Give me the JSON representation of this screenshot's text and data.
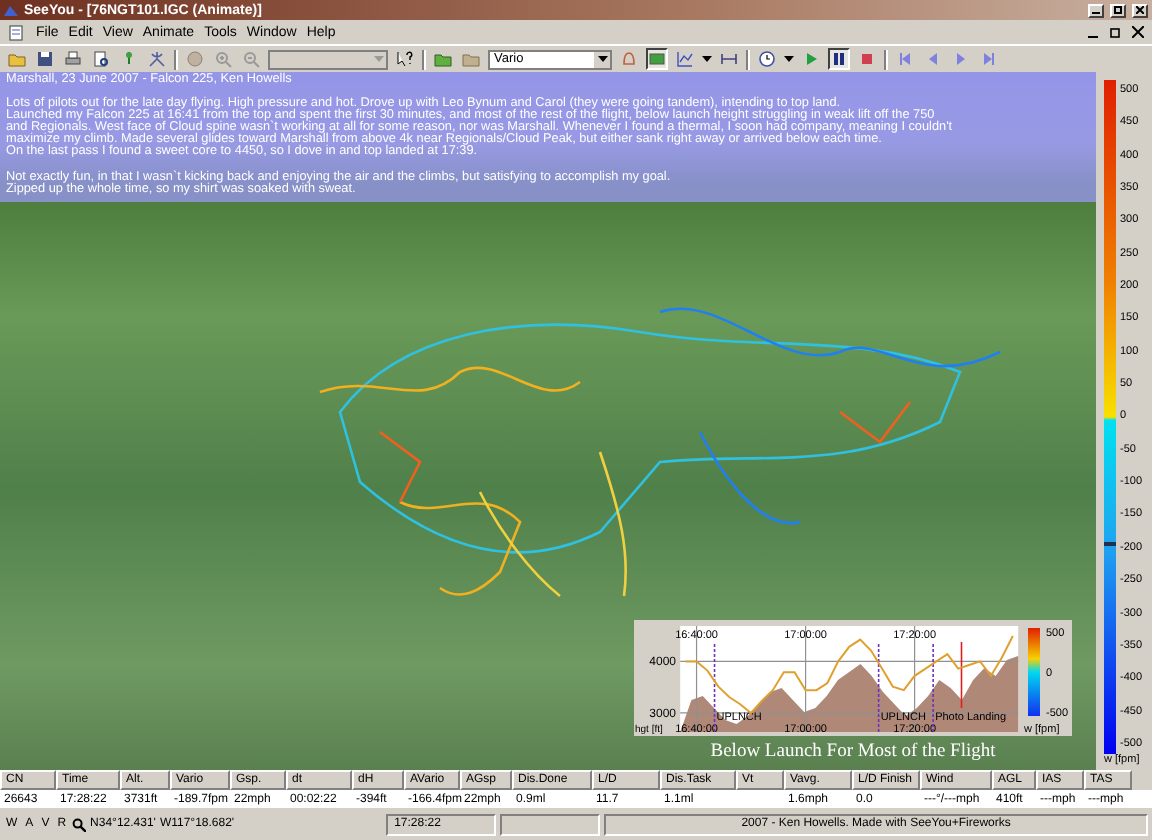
{
  "window": {
    "title": "SeeYou - [76NGT101.IGC (Animate)]"
  },
  "menu": [
    {
      "label": "File"
    },
    {
      "label": "Edit"
    },
    {
      "label": "View"
    },
    {
      "label": "Animate"
    },
    {
      "label": "Tools"
    },
    {
      "label": "Window"
    },
    {
      "label": "Help"
    }
  ],
  "toolbar": {
    "map_combo": {
      "disabled": true
    },
    "display_combo": {
      "value": "Vario"
    },
    "picture_button": {
      "pressed": true
    },
    "pause_button": {
      "pressed": true
    }
  },
  "notes": {
    "title": "Marshall, 23 June 2007 - Falcon 225, Ken Howells",
    "paragraphs": [
      {
        "lines": [
          "Lots of pilots out for the late day flying. High pressure and hot. Drove up with Leo Bynum and Carol (they were going tandem), intending to top land.",
          "Launched my Falcon 225 at 16:41 from the top and spent the first 30 minutes, and most of the rest of the flight, below launch height struggling in weak lift off the 750",
          "and Regionals. West face of Cloud spine wasn`t working at all for some reason, nor was Marshall. Whenever I found a thermal, I soon had company, meaning I couldn't",
          "maximize my climb. Made several glides toward Marshall from above 4k near Regionals/Cloud Peak, but either sank right away or arrived below each time.",
          "On the last pass I found a sweet core to 4450, so I dove in and top landed at 17:39."
        ]
      },
      {
        "lines": [
          "Not exactly fun, in that I wasn`t kicking back and enjoying the air and the climbs, but satisfying to accomplish my goal.",
          "Zipped up the whole time, so my shirt was soaked with sweat."
        ]
      }
    ]
  },
  "vario_scale": {
    "labels": [
      "500",
      "450",
      "400",
      "350",
      "300",
      "250",
      "200",
      "150",
      "100",
      "50",
      "0",
      "-50",
      "-100",
      "-150",
      "-200",
      "-250",
      "-300",
      "-350",
      "-400",
      "-450",
      "-500"
    ],
    "unit": "w [fpm]",
    "level": 0.31
  },
  "inset": {
    "caption": "Below Launch For Most of the Flight",
    "chart_data": {
      "type": "line",
      "ylabel": "hgt [ft]",
      "ylim": [
        2630,
        4685
      ],
      "categories": [
        null,
        "16:40:00",
        null,
        null,
        null,
        null,
        null,
        null,
        null,
        null,
        null,
        "17:00:00",
        null,
        null,
        null,
        null,
        null,
        null,
        null,
        null,
        null,
        "17:20:00",
        null,
        null,
        null,
        null,
        null,
        null,
        null,
        null,
        null
      ],
      "series": [
        {
          "color": "#e0a030",
          "values": [
            4000,
            4000,
            3820,
            3510,
            3310,
            3170,
            3000,
            3240,
            3440,
            3790,
            3790,
            3440,
            3440,
            3580,
            4000,
            4280,
            4420,
            4210,
            3860,
            3510,
            3440,
            3720,
            3860,
            4000,
            4140,
            3860,
            3930,
            4000,
            3720,
            4070,
            4490
          ]
        }
      ],
      "yticks": [
        3000,
        4000
      ],
      "grid": true,
      "annotations": [
        "UPLNCH",
        "UPLNCH",
        "Photo Landing"
      ]
    },
    "legend": {
      "labels": [
        "500",
        "0",
        "-500"
      ],
      "unit": "w [fpm]"
    }
  },
  "table": {
    "columns": [
      {
        "label": "CN",
        "value": "26643"
      },
      {
        "label": "Time",
        "value": "17:28:22"
      },
      {
        "label": "Alt.",
        "value": "3731ft"
      },
      {
        "label": "Vario",
        "value": "-189.7fpm"
      },
      {
        "label": "Gsp.",
        "value": "22mph"
      },
      {
        "label": "dt",
        "value": "00:02:22"
      },
      {
        "label": "dH",
        "value": "-394ft"
      },
      {
        "label": "AVario",
        "value": "-166.4fpm"
      },
      {
        "label": "AGsp",
        "value": "22mph"
      },
      {
        "label": "Dis.Done",
        "value": "0.9ml"
      },
      {
        "label": "L/D",
        "value": "11.7"
      },
      {
        "label": "Dis.Task",
        "value": "1.1ml"
      },
      {
        "label": "Vt"
      },
      {
        "label": "Vavg.",
        "value": "1.6mph"
      },
      {
        "label": "L/D Finish",
        "value": "0.0"
      },
      {
        "label": "Wind",
        "value": "---°/---mph"
      },
      {
        "label": "AGL",
        "value": "410ft"
      },
      {
        "label": "IAS",
        "value": "---mph"
      },
      {
        "label": "TAS",
        "value": "---mph"
      }
    ]
  },
  "status_bar": {
    "modes": [
      "W",
      "A",
      "V",
      "R"
    ],
    "latitude": "N34°12.431'",
    "longitude": "W117°18.682'",
    "time": "17:28:22",
    "credit": "2007 - Ken Howells. Made with SeeYou+Fireworks"
  }
}
